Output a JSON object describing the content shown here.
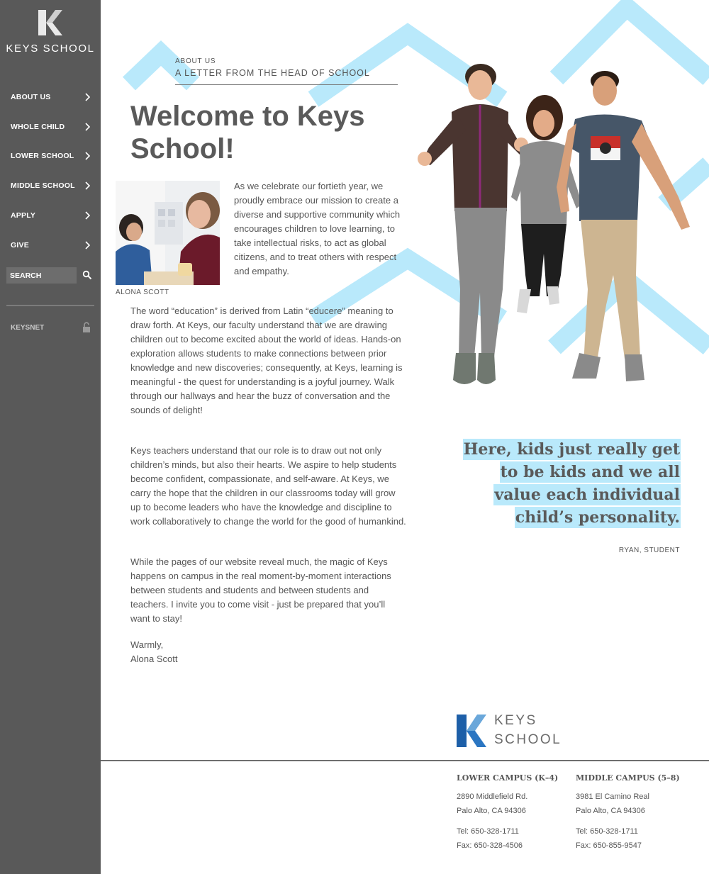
{
  "sidebar": {
    "logo_text": "KEYS SCHOOL",
    "nav": [
      "ABOUT US",
      "WHOLE CHILD",
      "LOWER SCHOOL",
      "MIDDLE SCHOOL",
      "APPLY",
      "GIVE"
    ],
    "search_placeholder": "SEARCH",
    "keysnet": "KEYSNET"
  },
  "letter": {
    "eyebrow": "ABOUT US",
    "section_heading": "A LETTER FROM THE HEAD OF SCHOOL",
    "title": "Welcome to Keys School!",
    "photo_caption": "ALONA SCOTT",
    "intro": "As we celebrate our fortieth year, we proudly embrace our mission to create a diverse and supportive community which encourages children to love learning, to take intellectual risks, to act as global citizens, and to treat others with respect and empathy.",
    "paragraphs": [
      "The word “education” is derived from Latin “educere” meaning to draw forth. At Keys, our faculty understand that we are drawing children out to become excited about the world of ideas. Hands-on exploration allows students to make connections between prior knowledge and new discoveries; consequently, at Keys, learning is meaningful - the quest for understanding is a joyful journey. Walk through our hallways and hear the buzz of conversation and the sounds of delight!",
      "Keys teachers understand that our role is to draw out not only children’s minds, but also their hearts. We aspire to help students become confident, compassionate, and self-aware. At Keys, we carry the hope that the children in our classrooms today will grow up to become leaders who have the knowledge and discipline to work collaboratively to change the world for the good of humankind.",
      "While the pages of our website reveal much, the magic of Keys happens on campus in the real moment-by-moment interactions between students and students and between students and teachers. I invite you to come visit - just be prepared that you’ll want to stay!"
    ],
    "closing": "Warmly,",
    "signature": "Alona Scott"
  },
  "quote": {
    "text": "Here, kids just really get to be kids and we all value each individual child’s personality.",
    "attribution": "RYAN, STUDENT"
  },
  "footer": {
    "logo_line1": "KEYS",
    "logo_line2": "SCHOOL",
    "campuses": [
      {
        "name": "LOWER CAMPUS (K–4)",
        "address1": "2890 Middlefield Rd.",
        "address2": "Palo Alto, CA 94306",
        "tel": "Tel: 650-328-1711",
        "fax": "Fax: 650-328-4506"
      },
      {
        "name": "MIDDLE CAMPUS (5–8)",
        "address1": "3981 El Camino Real",
        "address2": "Palo Alto, CA 94306",
        "tel": "Tel: 650-328-1711",
        "fax": "Fax: 650-855-9547"
      }
    ]
  },
  "colors": {
    "sidebar": "#595959",
    "chevron": "#b9e9fb",
    "brand_blue": "#1d5fa8",
    "text": "#555555"
  },
  "icons": [
    "chevron-right-icon",
    "search-icon",
    "lock-icon",
    "keys-logo-icon"
  ]
}
